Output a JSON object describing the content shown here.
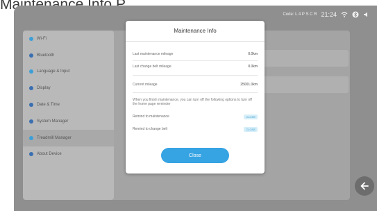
{
  "caption": {
    "text": "Maintenance Info Page"
  },
  "statusbar": {
    "code": "Code: L 4 P S C R",
    "time": "21:24"
  },
  "sidebar": {
    "items": [
      {
        "label": "Wi-Fi",
        "icon": "wifi-icon",
        "color": "#3d9fd6"
      },
      {
        "label": "Bluetooth",
        "icon": "bluetooth-icon",
        "color": "#3a6fb0"
      },
      {
        "label": "Language & Input",
        "icon": "language-icon",
        "color": "#3d9fd6"
      },
      {
        "label": "Display",
        "icon": "display-icon",
        "color": "#3a6fb0"
      },
      {
        "label": "Date & Time",
        "icon": "clock-icon",
        "color": "#3a6fb0"
      },
      {
        "label": "System Manager",
        "icon": "system-icon",
        "color": "#3a6fb0"
      },
      {
        "label": "Treadmill Manager",
        "icon": "treadmill-icon",
        "color": "#3d9fd6",
        "active": true
      },
      {
        "label": "About Device",
        "icon": "info-icon",
        "color": "#3a6fb0"
      }
    ]
  },
  "dialog": {
    "title": "Maintenance Info",
    "rows": [
      {
        "label": "Last maintenance mileage",
        "value": "0.0km"
      },
      {
        "label": "Last change belt mileage",
        "value": "0.0km"
      },
      {
        "label": "Current mileage",
        "value": "25001.0km"
      }
    ],
    "note": "When you finish maintenance, you can turn off the following options to turn off the home page reminder",
    "toggles": [
      {
        "label": "Remind to maintenance",
        "state": "CLOSE"
      },
      {
        "label": "Remind to change belt",
        "state": "CLOSE"
      }
    ],
    "close_label": "Close"
  },
  "colors": {
    "accent": "#36a3e3",
    "overlay": "#8f8f8f"
  }
}
